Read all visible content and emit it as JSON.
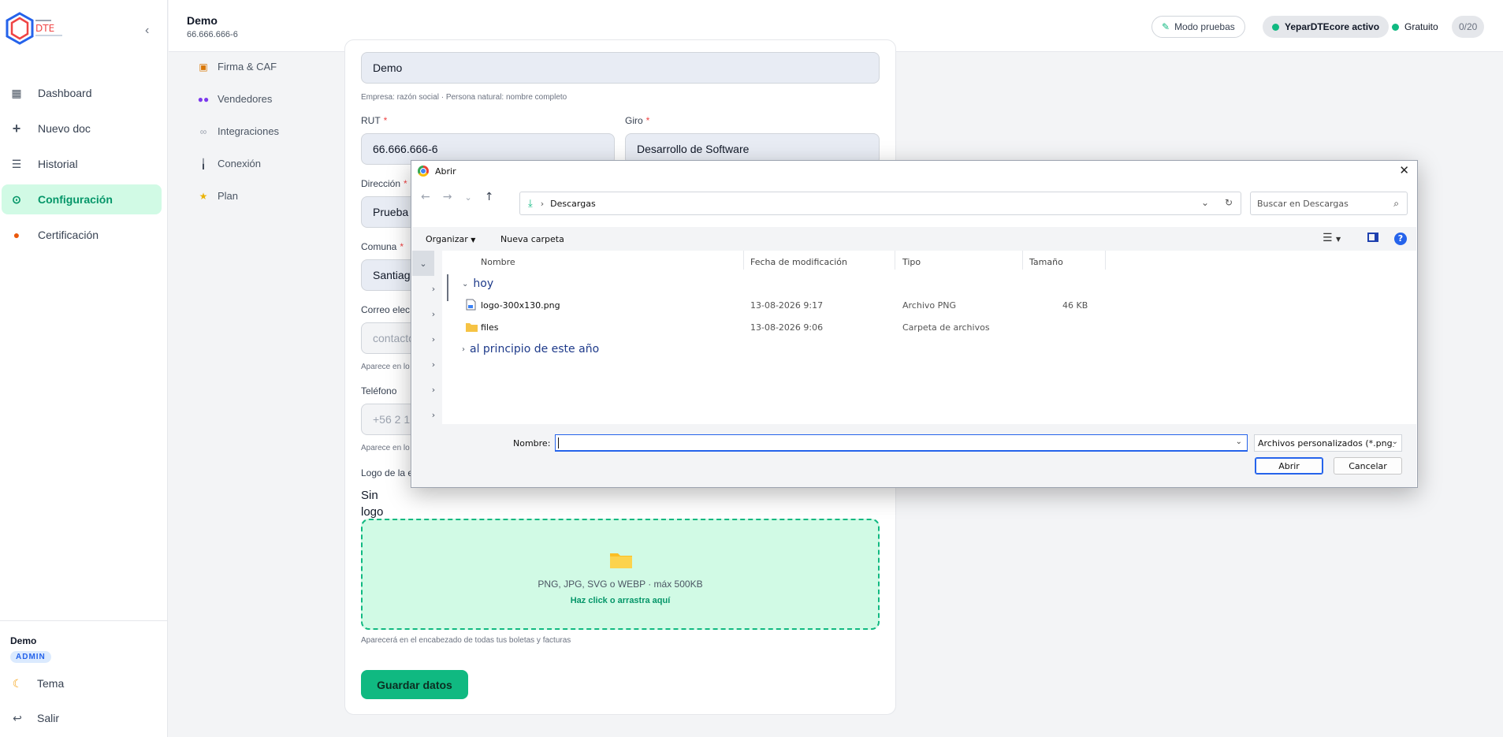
{
  "sidebar": {
    "collapse_icon": "chevron-left-icon",
    "items": [
      {
        "label": "Dashboard",
        "icon": "grid-icon"
      },
      {
        "label": "Nuevo doc",
        "icon": "plus-icon"
      },
      {
        "label": "Historial",
        "icon": "list-icon"
      },
      {
        "label": "Configuración",
        "icon": "gear-icon",
        "active": true
      },
      {
        "label": "Certificación",
        "icon": "medal-icon"
      }
    ],
    "user_name": "Demo",
    "user_role": "ADMIN",
    "theme_label": "Tema",
    "logout_label": "Salir"
  },
  "header": {
    "company": "Demo",
    "rut": "66.666.666-6",
    "test_mode_label": "Modo pruebas",
    "core_label": "YeparDTEcore activo",
    "plan_label": "Gratuito",
    "usage_count": "0/20"
  },
  "settings_nav": [
    {
      "label": "Firma & CAF",
      "icon": "certificate-icon"
    },
    {
      "label": "Vendedores",
      "icon": "users-icon"
    },
    {
      "label": "Integraciones",
      "icon": "link-icon"
    },
    {
      "label": "Conexión",
      "icon": "plug-icon"
    },
    {
      "label": "Plan",
      "icon": "star-icon"
    }
  ],
  "form": {
    "razon_social_value": "Demo",
    "razon_social_hint": "Empresa: razón social · Persona natural: nombre completo",
    "rut_label": "RUT",
    "rut_value": "66.666.666-6",
    "giro_label": "Giro",
    "giro_value": "Desarrollo de Software",
    "direccion_label": "Dirección",
    "direccion_value": "Prueba",
    "comuna_label": "Comuna",
    "comuna_value": "Santiago",
    "correo_label": "Correo elec",
    "correo_placeholder": "contacto",
    "correo_hint": "Aparece en lo",
    "telefono_label": "Teléfono",
    "telefono_placeholder": "+56 2 1",
    "telefono_hint": "Aparece en lo",
    "logo_label": "Logo de la e",
    "no_logo": "Sin logo",
    "drop_formats": "PNG, JPG, SVG o WEBP · máx 500KB",
    "drop_action": "Haz click o arrastra aquí",
    "logo_hint": "Aparecerá en el encabezado de todas tus boletas y facturas",
    "save_label": "Guardar datos"
  },
  "dialog": {
    "title": "Abrir",
    "path_folder": "Descargas",
    "search_placeholder": "Buscar en Descargas",
    "organize_label": "Organizar",
    "new_folder_label": "Nueva carpeta",
    "columns": [
      "Nombre",
      "Fecha de modificación",
      "Tipo",
      "Tamaño"
    ],
    "group_today": "hoy",
    "group_year": "al principio de este año",
    "files": [
      {
        "name": "logo-300x130.png",
        "date": "13-08-2026 9:17",
        "type": "Archivo PNG",
        "size": "46 KB",
        "icon": "image-file-icon"
      },
      {
        "name": "files",
        "date": "13-08-2026 9:06",
        "type": "Carpeta de archivos",
        "size": "",
        "icon": "folder-icon"
      }
    ],
    "name_label": "Nombre:",
    "name_value": "",
    "filter_value": "Archivos personalizados (*.png;",
    "open_label": "Abrir",
    "cancel_label": "Cancelar"
  },
  "colors": {
    "accent": "#10b981",
    "accent_bg": "#d1fae5",
    "dialog_link": "#1e3a8a"
  }
}
